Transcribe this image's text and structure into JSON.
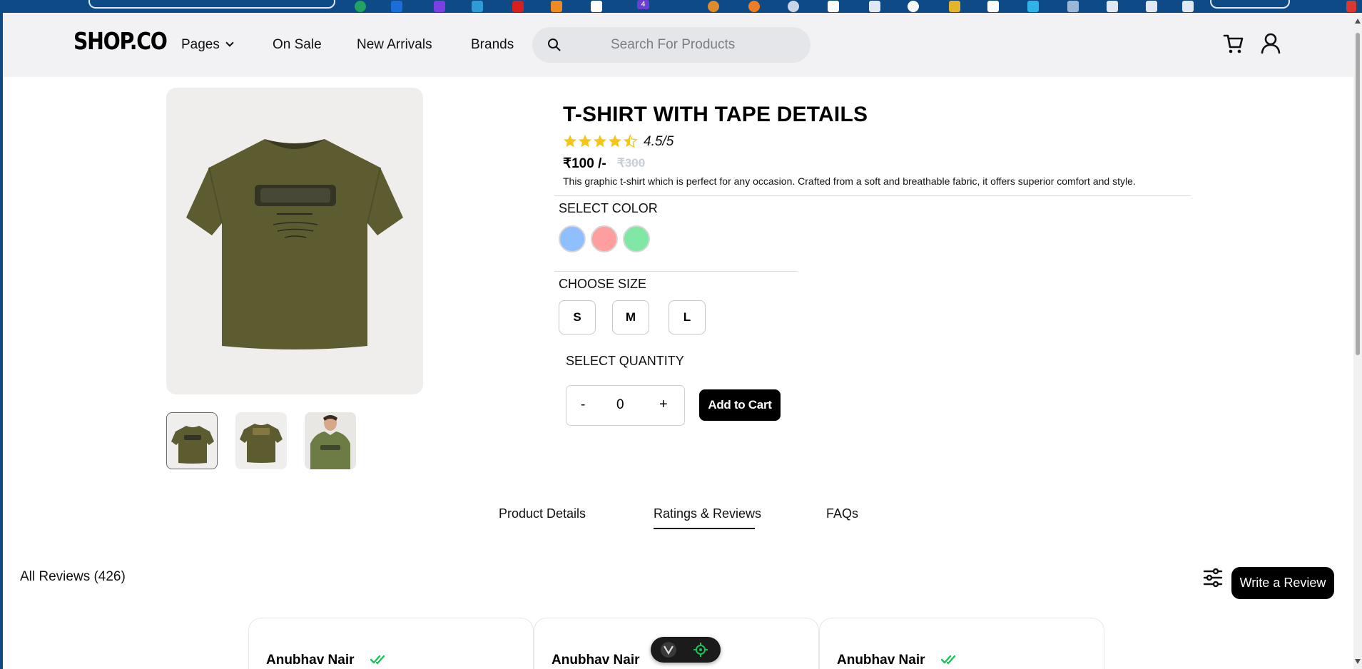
{
  "browser": {
    "extension_badge": "4"
  },
  "header": {
    "logo": "SHOP.CO",
    "nav": {
      "pages": "Pages",
      "on_sale": "On Sale",
      "new_arrivals": "New Arrivals",
      "brands": "Brands"
    },
    "search_placeholder": "Search For Products",
    "icons": [
      "search-icon",
      "cart-icon",
      "user-icon"
    ]
  },
  "product": {
    "title": "T-SHIRT WITH TAPE DETAILS",
    "rating": 4.5,
    "rating_text": "4.5/5",
    "price": "₹100 /-",
    "old_price": "₹300",
    "description": "This graphic t-shirt which is perfect for any occasion. Crafted from a soft and breathable fabric, it offers superior comfort and style.",
    "color_label": "SELECT COLOR",
    "colors": [
      "#8fbfff",
      "#ff9e9e",
      "#7fe8a4"
    ],
    "size_label": "CHOOSE SIZE",
    "sizes": [
      "S",
      "M",
      "L"
    ],
    "quantity_label": "SELECT QUANTITY",
    "quantity": {
      "minus": "-",
      "value": "0",
      "plus": "+"
    },
    "add_to_cart": "Add to Cart"
  },
  "tabs": {
    "details": "Product Details",
    "reviews": "Ratings & Reviews",
    "faqs": "FAQs",
    "active": "reviews"
  },
  "reviews": {
    "heading": "All Reviews (426)",
    "write_button": "Write a Review",
    "cards": [
      {
        "name": "Anubhav Nair"
      },
      {
        "name": "Anubhav Nair"
      },
      {
        "name": "Anubhav Nair"
      }
    ]
  },
  "colors": {
    "star": "#f5c518",
    "verified": "#19c25a",
    "header_bg": "#f2f1f3",
    "search_bg": "#e4e6ea",
    "shirt": "#5d5c31"
  }
}
